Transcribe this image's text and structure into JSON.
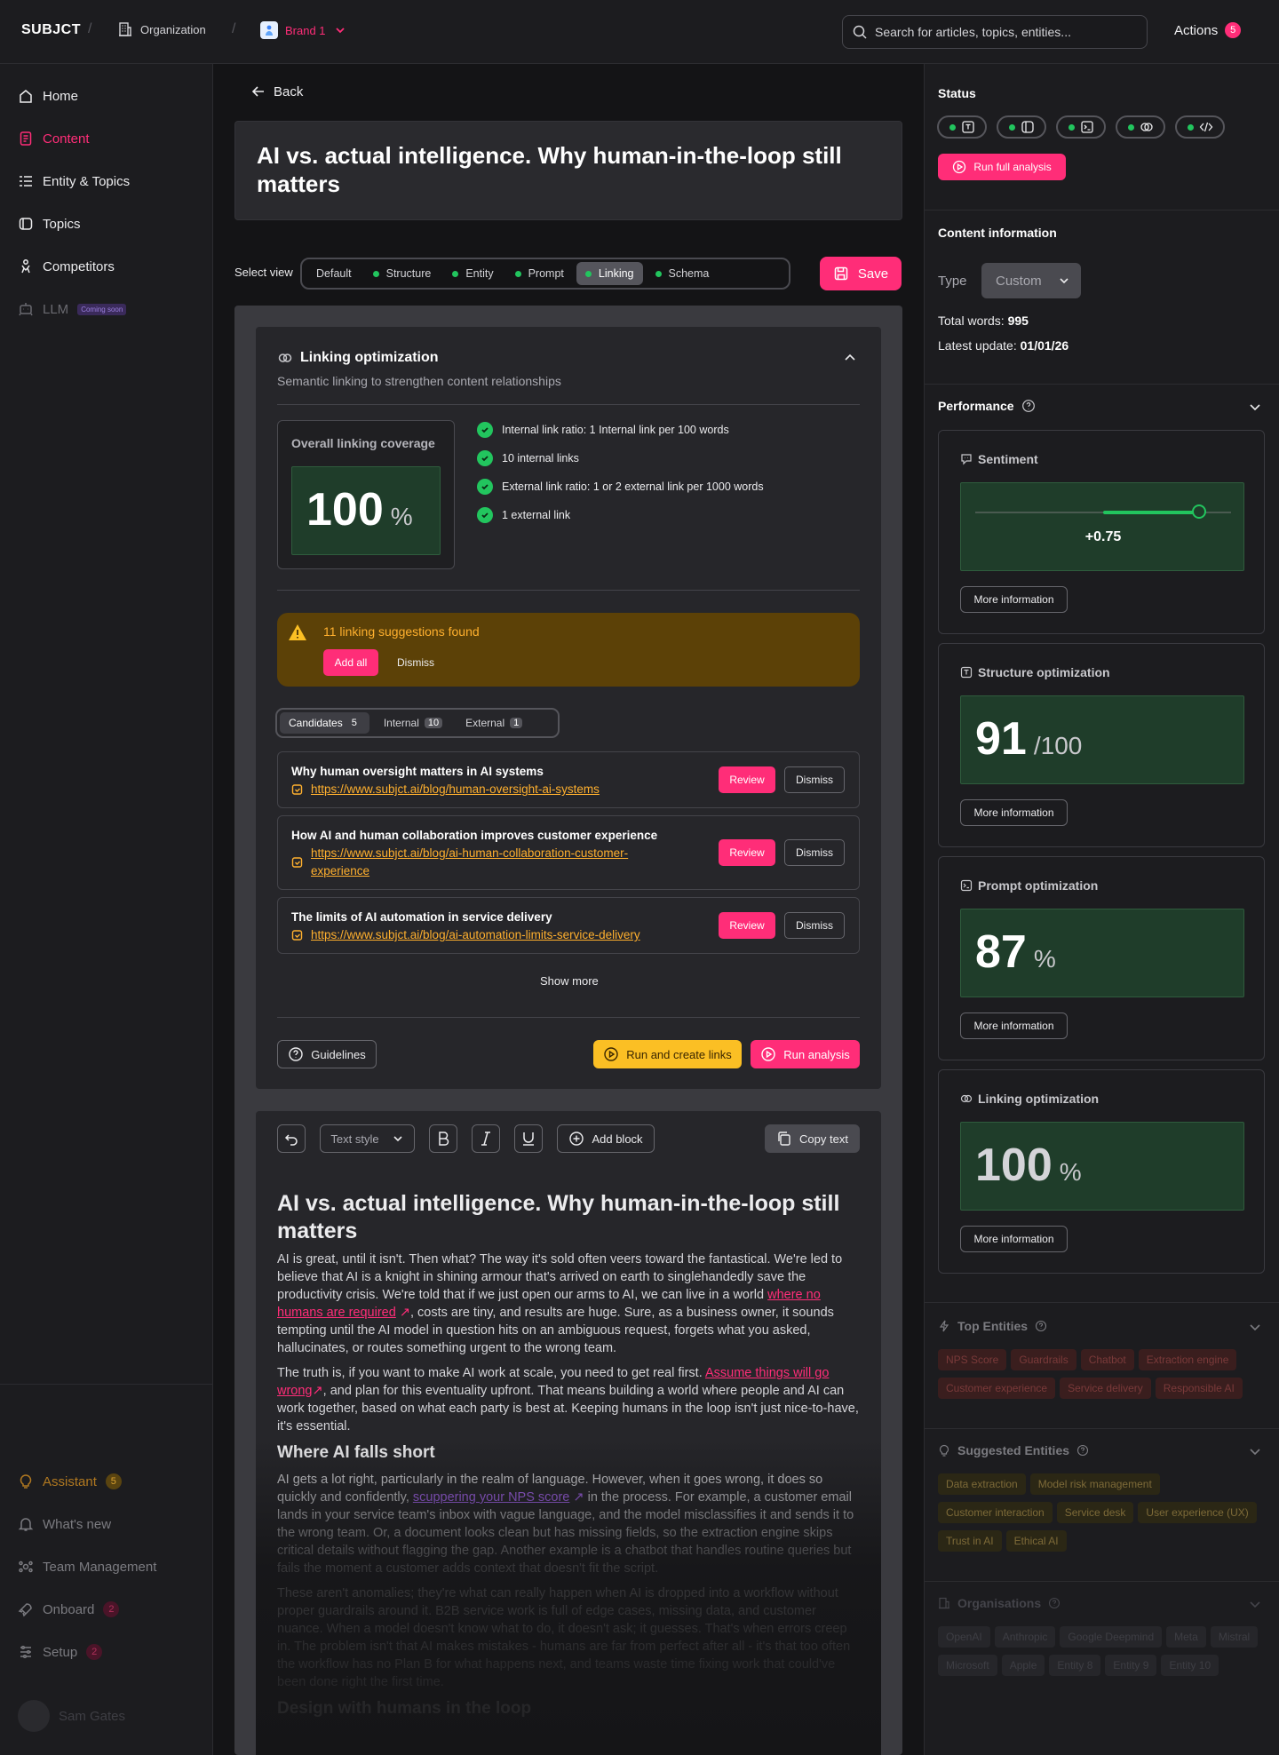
{
  "topbar": {
    "logo": "SUBJCT",
    "crumb_org": "Organization",
    "crumb_brand": "Brand 1",
    "search_placeholder": "Search for articles, topics, entities...",
    "actions_label": "Actions",
    "actions_count": "5"
  },
  "sidebar": {
    "items": [
      {
        "label": "Home"
      },
      {
        "label": "Content"
      },
      {
        "label": "Entity & Topics"
      },
      {
        "label": "Topics"
      },
      {
        "label": "Competitors"
      },
      {
        "label": "LLM",
        "tag": "Coming soon"
      }
    ],
    "bottom": [
      {
        "label": "Assistant",
        "badge": "5"
      },
      {
        "label": "What's new"
      },
      {
        "label": "Team Management"
      },
      {
        "label": "Onboard",
        "badge": "2"
      },
      {
        "label": "Setup",
        "badge": "2"
      }
    ],
    "user": "Sam Gates"
  },
  "main": {
    "back_label": "Back",
    "title": "AI vs. actual intelligence. Why human-in-the-loop still matters",
    "select_view_label": "Select view",
    "views": [
      "Default",
      "Structure",
      "Entity",
      "Prompt",
      "Linking",
      "Schema"
    ],
    "active_view": "Linking",
    "save_label": "Save"
  },
  "linking": {
    "title": "Linking optimization",
    "subtitle": "Semantic linking to strengthen content relationships",
    "coverage_label": "Overall linking coverage",
    "coverage_value": "100",
    "coverage_unit": "%",
    "checks": [
      "Internal link ratio: 1 Internal link per 100 words",
      "10 internal links",
      "External link ratio: 1 or 2 external link per 1000 words",
      "1 external link"
    ],
    "suggestions_title": "11 linking suggestions found",
    "add_all_label": "Add all",
    "dismiss_label": "Dismiss",
    "filter_tabs": [
      {
        "label": "Candidates",
        "count": "5"
      },
      {
        "label": "Internal",
        "count": "10"
      },
      {
        "label": "External",
        "count": "1"
      }
    ],
    "candidates": [
      {
        "title": "Why human oversight matters in AI systems",
        "url": "https://www.subjct.ai/blog/human-oversight-ai-systems"
      },
      {
        "title": "How AI and human collaboration improves customer experience",
        "url": "https://www.subjct.ai/blog/ai-human-collaboration-customer-experience"
      },
      {
        "title": "The limits of AI automation in service delivery",
        "url": "https://www.subjct.ai/blog/ai-automation-limits-service-delivery"
      }
    ],
    "review_label": "Review",
    "show_more_label": "Show more",
    "guidelines_label": "Guidelines",
    "run_create_label": "Run and create links",
    "run_analysis_label": "Run analysis"
  },
  "editor": {
    "text_style_label": "Text style",
    "add_block_label": "Add block",
    "copy_label": "Copy text",
    "heading": "AI vs. actual intelligence. Why human-in-the-loop still matters",
    "p1_a": "AI is great, until it isn't. Then what? The way it's sold often veers toward the fantastical. We're led to believe that AI is a knight in shining armour that's arrived on earth to singlehandedly save the productivity crisis. We're told that if we just open our arms to AI, we can live in a world ",
    "p1_link": "where no humans are required",
    "p1_b": ", costs are tiny, and results are huge. Sure, as a business owner, it sounds tempting until the AI model in question hits on an ambiguous request, forgets what you asked, hallucinates, or routes something urgent to the wrong team.",
    "p2_a": "The truth is, if you want to make AI work at scale, you need to get real first. ",
    "p2_link": "Assume things will go wrong",
    "p2_b": ", and plan for this eventuality upfront. That means building a world where people and AI can work together, based on what each party is best at. Keeping humans in the loop isn't just nice-to-have, it's essential.",
    "h_fall": "Where AI falls short",
    "p3_a": "AI gets a lot right, particularly in the realm of language. However, when it goes wrong, it does so quickly and confidently, ",
    "p3_link": "scuppering your NPS score",
    "p3_b": " in the process. For example, a customer email lands in your service team's inbox with vague language, and the model misclassifies it and sends it to the wrong team. Or, a document looks clean but has missing fields, so the extraction engine skips critical details without flagging the gap. Another example is a chatbot that handles routine queries but fails the moment a customer adds context that doesn't fit the script.",
    "p4": "These aren't anomalies; they're what can really happen when AI is dropped into a workflow without proper guardrails around it. B2B service work is full of edge cases, missing data, and customer nuance. When a model doesn't know what to do, it doesn't ask; it guesses. That's when errors creep in. The problem isn't that AI makes mistakes - humans are far from perfect after all - it's that too often the workflow has no Plan B for what happens next, and teams waste time fixing work that could've been done right the first time.",
    "h_design": "Design with humans in the loop"
  },
  "right": {
    "status_label": "Status",
    "run_full_label": "Run full analysis",
    "content_info_label": "Content information",
    "type_label": "Type",
    "type_value": "Custom",
    "total_words_label": "Total words:",
    "total_words_value": "995",
    "latest_update_label": "Latest update:",
    "latest_update_value": "01/01/26",
    "performance_label": "Performance",
    "sentiment_label": "Sentiment",
    "sentiment_value": "+0.75",
    "sentiment_level": 0.75,
    "structure_label": "Structure optimization",
    "structure_value": "91",
    "structure_unit": "/100",
    "prompt_label": "Prompt optimization",
    "prompt_value": "87",
    "prompt_unit": "%",
    "linking_label": "Linking optimization",
    "linking_value": "100",
    "linking_unit": "%",
    "more_info_label": "More information",
    "top_entities_label": "Top Entities",
    "top_entities": [
      "NPS Score",
      "Guardrails",
      "Chatbot",
      "Extraction engine",
      "Customer experience",
      "Service delivery",
      "Responsible AI"
    ],
    "suggested_entities_label": "Suggested Entities",
    "suggested_entities": [
      "Data extraction",
      "Model risk management",
      "Customer interaction",
      "Service desk",
      "User experience (UX)",
      "Trust in AI",
      "Ethical AI"
    ],
    "organisations_label": "Organisations",
    "organisations": [
      "OpenAI",
      "Anthropic",
      "Google Deepmind",
      "Meta",
      "Mistral",
      "Microsoft",
      "Apple",
      "Entity 8",
      "Entity 9",
      "Entity 10"
    ]
  },
  "colors": {
    "accent": "#ff2d78",
    "success": "#22c55e",
    "warning": "#fbbf24",
    "score_bg": "#1f3d2a"
  }
}
